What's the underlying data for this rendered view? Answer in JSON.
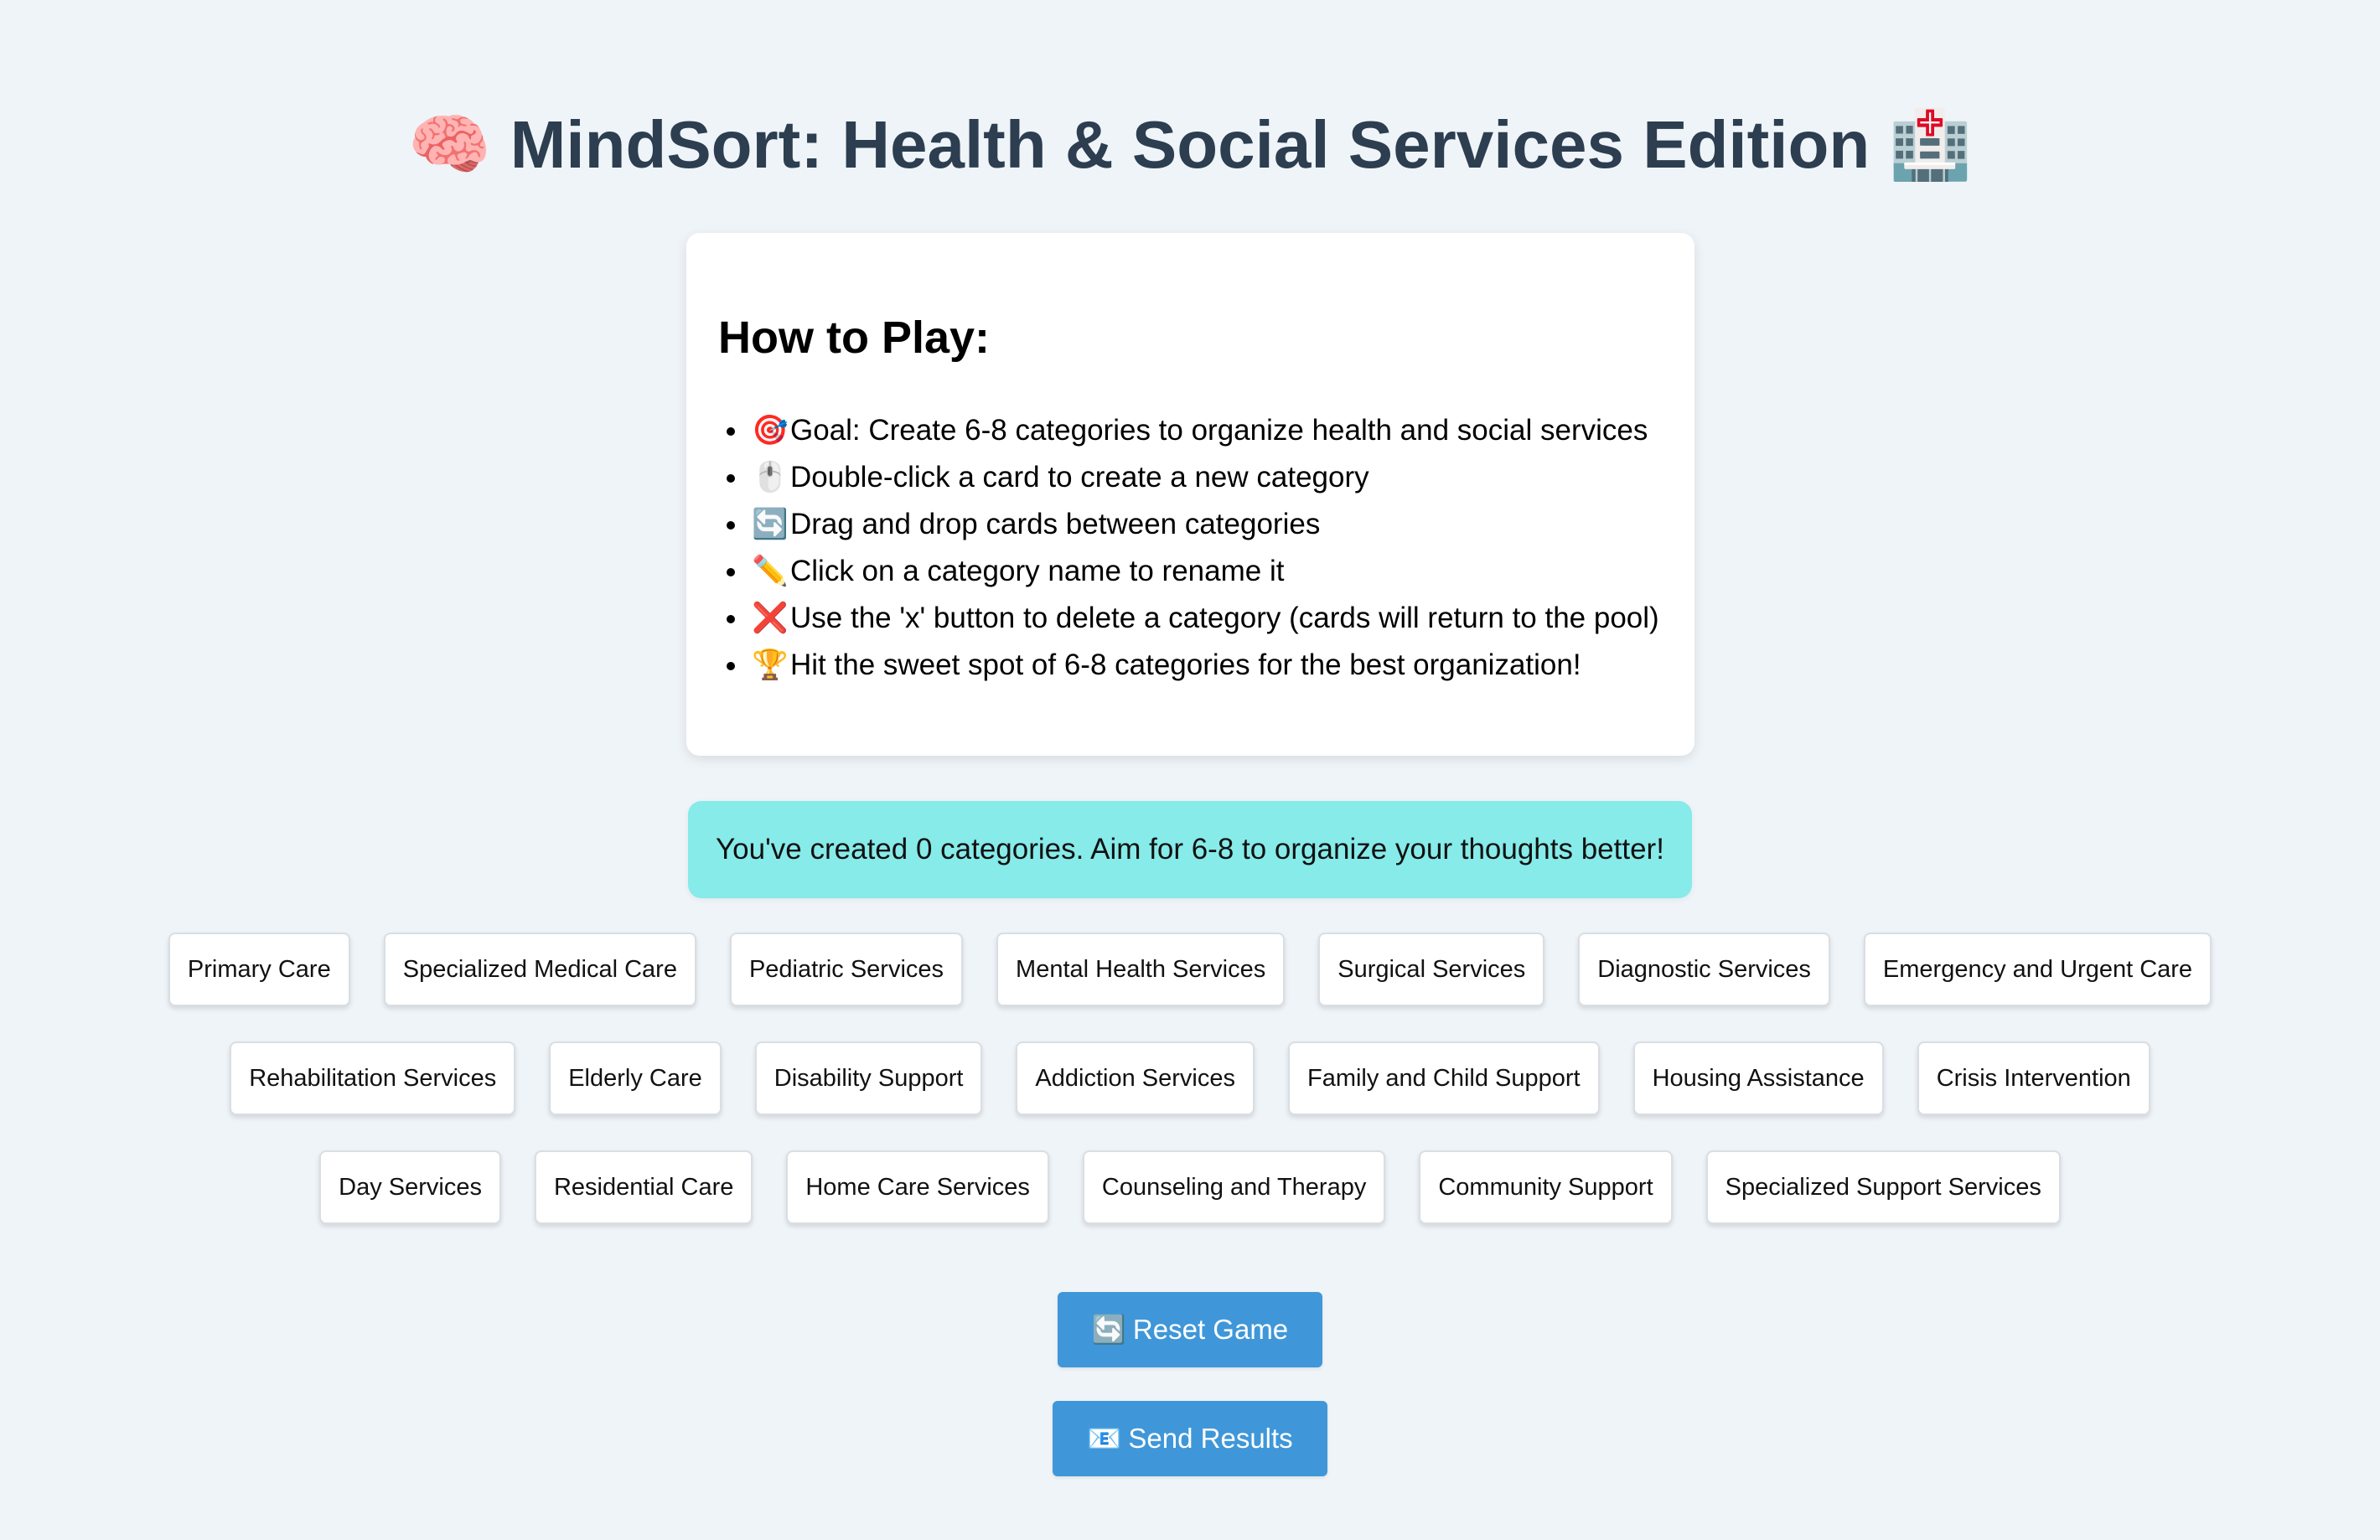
{
  "header": {
    "icon_left": "🧠",
    "title": "MindSort: Health & Social Services Edition",
    "icon_right": "🏥"
  },
  "instructions": {
    "heading": "How to Play:",
    "items": [
      {
        "icon": "🎯",
        "text": "Goal: Create 6-8 categories to organize health and social services"
      },
      {
        "icon": "🖱️",
        "text": "Double-click a card to create a new category"
      },
      {
        "icon": "🔄",
        "text": "Drag and drop cards between categories"
      },
      {
        "icon": "✏️",
        "text": "Click on a category name to rename it"
      },
      {
        "icon": "❌",
        "text": "Use the 'x' button to delete a category (cards will return to the pool)"
      },
      {
        "icon": "🏆",
        "text": "Hit the sweet spot of 6-8 categories for the best organization!"
      }
    ]
  },
  "status": {
    "message": "You've created 0 categories. Aim for 6-8 to organize your thoughts better!"
  },
  "cards": [
    "Primary Care",
    "Specialized Medical Care",
    "Pediatric Services",
    "Mental Health Services",
    "Surgical Services",
    "Diagnostic Services",
    "Emergency and Urgent Care",
    "Rehabilitation Services",
    "Elderly Care",
    "Disability Support",
    "Addiction Services",
    "Family and Child Support",
    "Housing Assistance",
    "Crisis Intervention",
    "Day Services",
    "Residential Care",
    "Home Care Services",
    "Counseling and Therapy",
    "Community Support",
    "Specialized Support Services"
  ],
  "buttons": {
    "reset": {
      "icon": "🔄",
      "label": "Reset Game"
    },
    "send": {
      "icon": "📧",
      "label": "Send Results"
    }
  },
  "colors": {
    "background": "#eff4f8",
    "title": "#2c3e50",
    "status_background": "#86ebe9",
    "button_background": "#3f97d9"
  }
}
